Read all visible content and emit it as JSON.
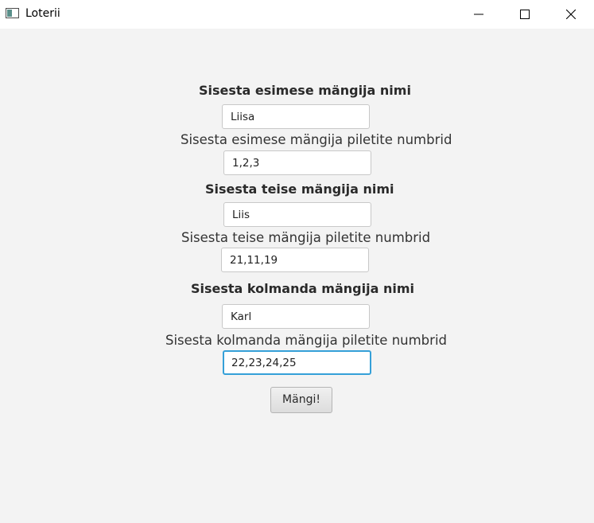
{
  "window": {
    "title": "Loterii"
  },
  "form": {
    "player1": {
      "name_label": "Sisesta esimese mängija nimi",
      "name_value": "Liisa",
      "tickets_label": "Sisesta esimese mängija piletite numbrid",
      "tickets_value": "1,2,3"
    },
    "player2": {
      "name_label": "Sisesta teise mängija nimi",
      "name_value": "Liis",
      "tickets_label": "Sisesta teise mängija piletite numbrid",
      "tickets_value": "21,11,19"
    },
    "player3": {
      "name_label": "Sisesta kolmanda mängija nimi",
      "name_value": "Karl",
      "tickets_label": "Sisesta kolmanda mängija piletite numbrid",
      "tickets_value": "22,23,24,25"
    },
    "play_button_label": "Mängi!"
  }
}
